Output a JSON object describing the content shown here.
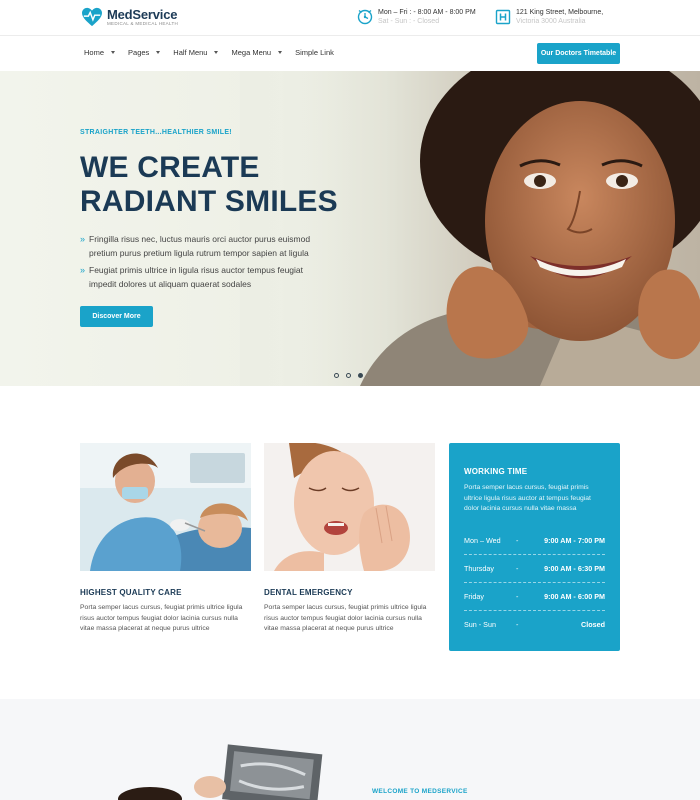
{
  "header": {
    "brand": "MedService",
    "tagline": "MEDICAL & MEDICAL HEALTH",
    "hours_line1": "Mon – Fri : - 8:00 AM - 8:00 PM",
    "hours_line2": "Sat - Sun : - Closed",
    "address_line1": "121 King Street, Melbourne,",
    "address_line2": "Victoria 3000 Australia"
  },
  "nav": {
    "items": [
      {
        "label": "Home"
      },
      {
        "label": "Pages"
      },
      {
        "label": "Half Menu"
      },
      {
        "label": "Mega Menu"
      },
      {
        "label": "Simple Link"
      }
    ],
    "cta_label": "Our Doctors Timetable"
  },
  "hero": {
    "subtitle": "STRAIGHTER TEETH...HEALTHIER SMILE!",
    "title_line1": "WE CREATE",
    "title_line2": "RADIANT SMILES",
    "bullets": [
      "Fringilla risus nec, luctus mauris orci auctor purus euismod pretium purus pretium ligula rutrum tempor sapien at ligula",
      "Feugiat primis ultrice in ligula risus auctor tempus feugiat impedit dolores ut aliquam quaerat sodales"
    ],
    "button_label": "Discover More",
    "slides_total": 3,
    "active_slide": 3
  },
  "features": [
    {
      "title": "HIGHEST QUALITY CARE",
      "text": "Porta semper lacus cursus, feugiat primis ultrice ligula risus auctor tempus feugiat dolor lacinia cursus nulla vitae massa placerat at neque purus ultrice"
    },
    {
      "title": "DENTAL EMERGENCY",
      "text": "Porta semper lacus cursus, feugiat primis ultrice ligula risus auctor tempus feugiat dolor lacinia cursus nulla vitae massa placerat at neque purus ultrice"
    }
  ],
  "working_time": {
    "title": "WORKING TIME",
    "description": "Porta semper lacus cursus, feugiat primis ultrice ligula risus auctor at tempus feugiat dolor lacinia cursus nulla vitae massa",
    "rows": [
      {
        "day": "Mon – Wed",
        "sep": "-",
        "time": "9:00 AM - 7:00 PM"
      },
      {
        "day": "Thursday",
        "sep": "-",
        "time": "9:00 AM - 6:30 PM"
      },
      {
        "day": "Friday",
        "sep": "-",
        "time": "9:00 AM - 6:00 PM"
      },
      {
        "day": "Sun - Sun",
        "sep": "-",
        "time": "Closed"
      }
    ]
  },
  "about": {
    "eyebrow": "WELCOME TO MEDSERVICE"
  },
  "colors": {
    "accent": "#1aa3c9",
    "heading": "#1b3a55"
  }
}
